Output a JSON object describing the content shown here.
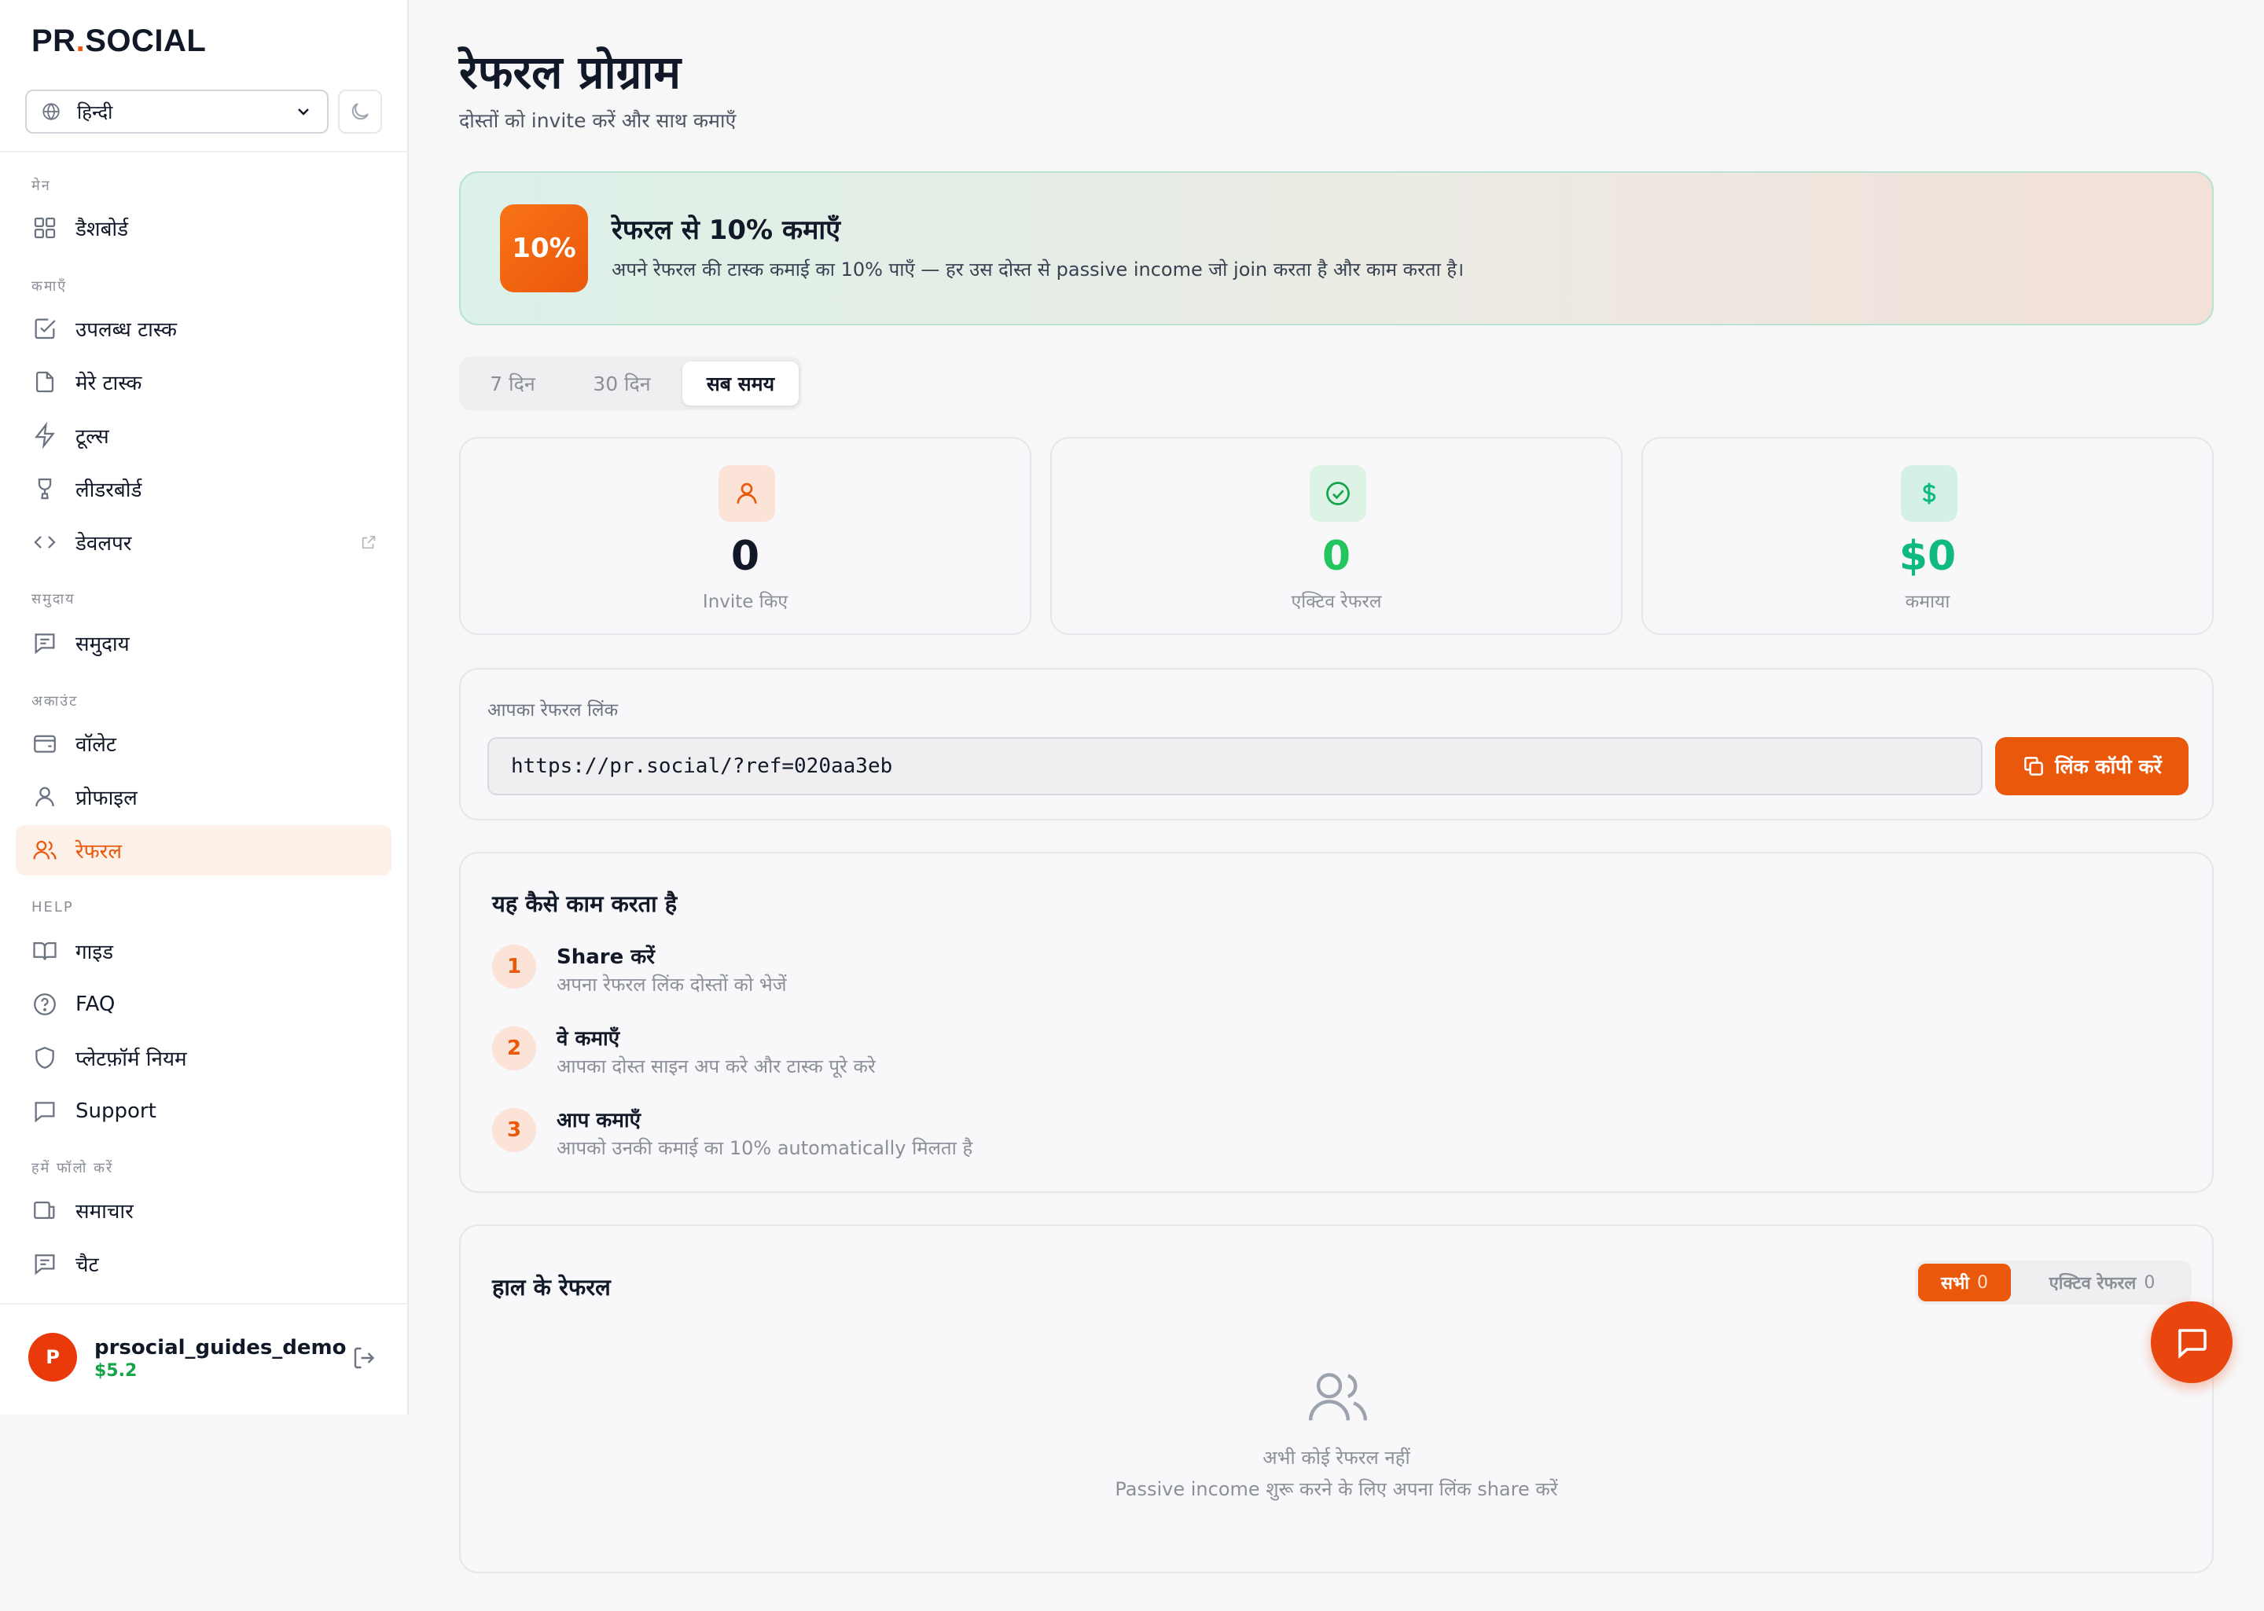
{
  "brand": {
    "left": "PR",
    "dot": ".",
    "right": "SOCIAL"
  },
  "sidebar": {
    "language": "हिन्दी",
    "sections": {
      "main": "मेन",
      "earn": "कमाएँ",
      "community": "समुदाय",
      "account": "अकाउंट",
      "help": "HELP",
      "follow": "हमें फॉलो करें"
    },
    "items": {
      "dashboard": "डैशबोर्ड",
      "available_tasks": "उपलब्ध टास्क",
      "my_tasks": "मेरे टास्क",
      "tools": "टूल्स",
      "leaderboard": "लीडरबोर्ड",
      "developer": "डेवलपर",
      "community": "समुदाय",
      "wallet": "वॉलेट",
      "profile": "प्रोफाइल",
      "referral": "रेफरल",
      "guide": "गाइड",
      "faq": "FAQ",
      "platform_rules": "प्लेटफ़ॉर्म नियम",
      "support": "Support",
      "news": "समाचार",
      "chat": "चैट"
    },
    "user": {
      "initial": "P",
      "name": "prsocial_guides_demo",
      "balance": "$5.2"
    }
  },
  "page": {
    "title": "रेफरल प्रोग्राम",
    "subtitle": "दोस्तों को invite करें और साथ कमाएँ"
  },
  "promo": {
    "badge": "10%",
    "title": "रेफरल से 10% कमाएँ",
    "description": "अपने रेफरल की टास्क कमाई का 10% पाएँ — हर उस दोस्त से passive income जो join करता है और काम करता है।"
  },
  "range_tabs": {
    "d7": "7 दिन",
    "d30": "30 दिन",
    "all": "सब समय",
    "selected": "सब समय"
  },
  "stats": {
    "invited": {
      "value": "0",
      "label": "Invite किए"
    },
    "active": {
      "value": "0",
      "label": "एक्टिव रेफरल"
    },
    "earned": {
      "value": "$0",
      "label": "कमाया"
    }
  },
  "referral_link": {
    "label": "आपका रेफरल लिंक",
    "value": "https://pr.social/?ref=020aa3eb",
    "copy_label": "लिंक कॉपी करें"
  },
  "how_it_works": {
    "title": "यह कैसे काम करता है",
    "steps": [
      {
        "num": "1",
        "title": "Share करें",
        "desc": "अपना रेफरल लिंक दोस्तों को भेजें"
      },
      {
        "num": "2",
        "title": "वे कमाएँ",
        "desc": "आपका दोस्त साइन अप करे और टास्क पूरे करे"
      },
      {
        "num": "3",
        "title": "आप कमाएँ",
        "desc": "आपको उनकी कमाई का 10% automatically मिलता है"
      }
    ]
  },
  "recent": {
    "title": "हाल के रेफरल",
    "filter_all": "सभी",
    "filter_all_count": "0",
    "filter_active": "एक्टिव रेफरल",
    "filter_active_count": "0",
    "empty_title": "अभी कोई रेफरल नहीं",
    "empty_desc": "Passive income शुरू करने के लिए अपना लिंक share करें"
  },
  "colors": {
    "accent": "#ea580c",
    "success": "#16a34a",
    "muted": "#8a8f98"
  },
  "icons": {
    "language": "globe-icon",
    "theme": "moon-icon",
    "chat_fab": "message-square-icon",
    "logout": "logout-icon"
  }
}
